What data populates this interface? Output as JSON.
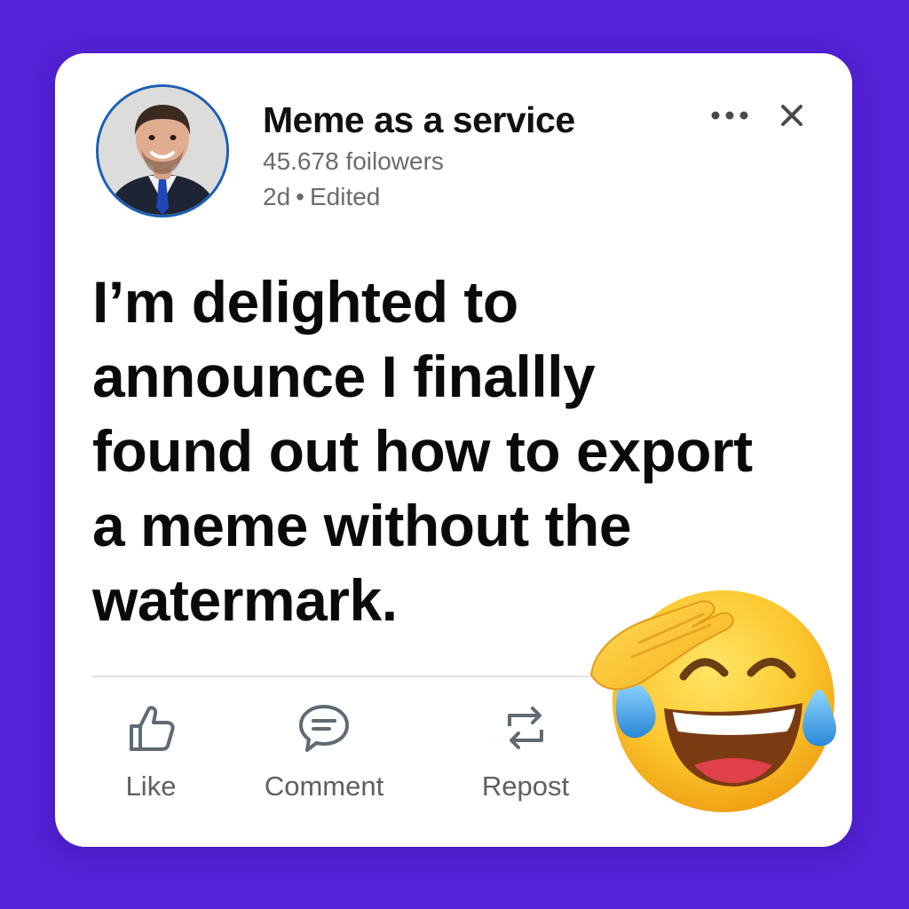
{
  "post": {
    "author": {
      "name": "Meme as a service",
      "followers": "45.678 foilowers",
      "time": "2d",
      "separator": "•",
      "edited": "Edited",
      "avatar_icon": "person-portrait-icon"
    },
    "header_actions": {
      "more_icon": "more-horizontal-icon",
      "close_icon": "close-icon"
    },
    "body_lines": [
      "I’m delighted to",
      "announce I finallly",
      "found out how to export",
      "a meme without the",
      "watermark."
    ],
    "actions": [
      {
        "label": "Like",
        "icon": "thumbs-up-icon"
      },
      {
        "label": "Comment",
        "icon": "comment-bubble-icon"
      },
      {
        "label": "Repost",
        "icon": "repost-arrows-icon"
      }
    ],
    "sticker": "saluting-laughing-tears-emoji"
  },
  "colors": {
    "background": "#5322d6",
    "card": "#ffffff",
    "avatar_ring": "#1a5fb4",
    "name_text": "#111111",
    "meta_text": "#6b6b6b",
    "action_icon": "#5f6b73"
  }
}
